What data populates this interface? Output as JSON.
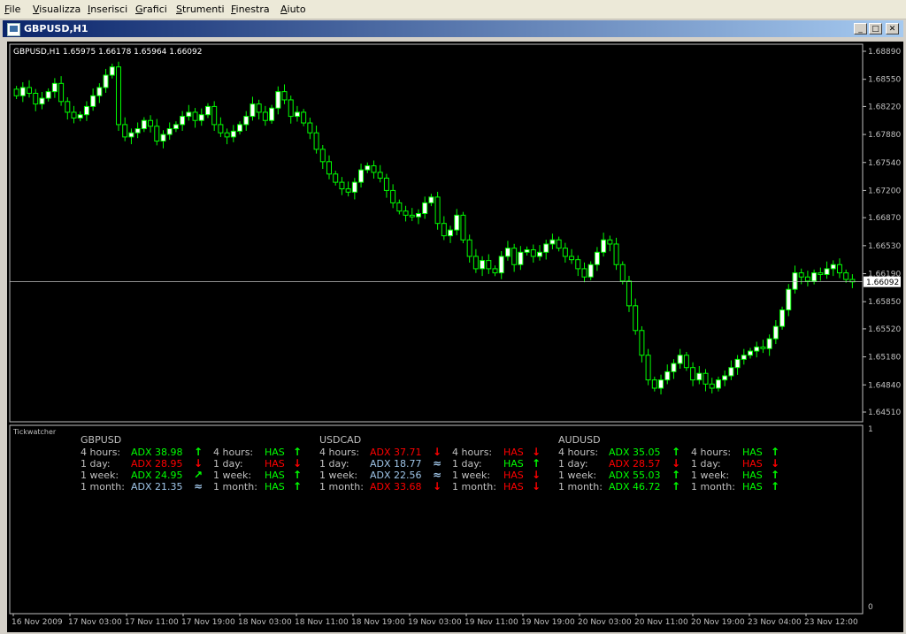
{
  "menu": [
    "File",
    "Visualizza",
    "Inserisci",
    "Grafici",
    "Strumenti",
    "Finestra",
    "Aiuto"
  ],
  "window": {
    "title": "GBPUSD,H1",
    "min_symbol": "_",
    "max_symbol": "□",
    "close_symbol": "✕"
  },
  "chart": {
    "symbol_line": "GBPUSD,H1  1.65975 1.66178 1.65964 1.66092",
    "price_ticks": [
      "1.68890",
      "1.68550",
      "1.68220",
      "1.67880",
      "1.67540",
      "1.67200",
      "1.66870",
      "1.66530",
      "1.66190",
      "1.65850",
      "1.65520",
      "1.65180",
      "1.64840",
      "1.64510"
    ],
    "current_price": "1.66092",
    "time_labels": [
      "16 Nov 2009",
      "17 Nov 03:00",
      "17 Nov 11:00",
      "17 Nov 19:00",
      "18 Nov 03:00",
      "18 Nov 11:00",
      "18 Nov 19:00",
      "19 Nov 03:00",
      "19 Nov 11:00",
      "19 Nov 19:00",
      "20 Nov 03:00",
      "20 Nov 11:00",
      "20 Nov 19:00",
      "23 Nov 04:00",
      "23 Nov 12:00"
    ],
    "indicator_name": "Tickwatcher",
    "indicator_scale_top": "1",
    "indicator_scale_bottom": "0",
    "colors": {
      "candle": "#00ff00",
      "bull_fill": "#ffffff",
      "bear_fill": "#000000",
      "green": "#00ff00",
      "red": "#ff0000",
      "blue": "#9fc5e8",
      "text": "#c0c0c0"
    }
  },
  "tickwatcher": [
    {
      "pair": "GBPUSD",
      "rows": [
        {
          "label": "4 hours:",
          "adx": "ADX 38.98",
          "adx_color": "green",
          "arrow": "up",
          "has_label": "4 hours:",
          "has": "HAS",
          "has_color": "green",
          "has_arrow": "up"
        },
        {
          "label": "1 day:",
          "adx": "ADX 28.95",
          "adx_color": "red",
          "arrow": "down",
          "has_label": "1 day:",
          "has": "HAS",
          "has_color": "red",
          "has_arrow": "down"
        },
        {
          "label": "1 week:",
          "adx": "ADX 24.95",
          "adx_color": "green",
          "arrow": "upright",
          "has_label": "1 week:",
          "has": "HAS",
          "has_color": "green",
          "has_arrow": "up"
        },
        {
          "label": "1 month:",
          "adx": "ADX 21.35",
          "adx_color": "blue",
          "arrow": "wave",
          "has_label": "1 month:",
          "has": "HAS",
          "has_color": "green",
          "has_arrow": "up"
        }
      ]
    },
    {
      "pair": "USDCAD",
      "rows": [
        {
          "label": "4 hours:",
          "adx": "ADX 37.71",
          "adx_color": "red",
          "arrow": "down",
          "has_label": "4 hours:",
          "has": "HAS",
          "has_color": "red",
          "has_arrow": "down"
        },
        {
          "label": "1 day:",
          "adx": "ADX 18.77",
          "adx_color": "blue",
          "arrow": "wave",
          "has_label": "1 day:",
          "has": "HAS",
          "has_color": "green",
          "has_arrow": "up"
        },
        {
          "label": "1 week:",
          "adx": "ADX 22.56",
          "adx_color": "blue",
          "arrow": "wave",
          "has_label": "1 week:",
          "has": "HAS",
          "has_color": "red",
          "has_arrow": "down"
        },
        {
          "label": "1 month:",
          "adx": "ADX 33.68",
          "adx_color": "red",
          "arrow": "down",
          "has_label": "1 month:",
          "has": "HAS",
          "has_color": "red",
          "has_arrow": "down"
        }
      ]
    },
    {
      "pair": "AUDUSD",
      "rows": [
        {
          "label": "4 hours:",
          "adx": "ADX 35.05",
          "adx_color": "green",
          "arrow": "up",
          "has_label": "4 hours:",
          "has": "HAS",
          "has_color": "green",
          "has_arrow": "up"
        },
        {
          "label": "1 day:",
          "adx": "ADX 28.57",
          "adx_color": "red",
          "arrow": "down",
          "has_label": "1 day:",
          "has": "HAS",
          "has_color": "red",
          "has_arrow": "down"
        },
        {
          "label": "1 week:",
          "adx": "ADX 55.03",
          "adx_color": "green",
          "arrow": "up",
          "has_label": "1 week:",
          "has": "HAS",
          "has_color": "green",
          "has_arrow": "up"
        },
        {
          "label": "1 month:",
          "adx": "ADX 46.72",
          "adx_color": "green",
          "arrow": "up",
          "has_label": "1 month:",
          "has": "HAS",
          "has_color": "green",
          "has_arrow": "up"
        }
      ]
    }
  ],
  "closes": [
    1.6835,
    1.6845,
    1.6838,
    1.6825,
    1.6832,
    1.684,
    1.685,
    1.6828,
    1.6815,
    1.6808,
    1.6812,
    1.6822,
    1.6835,
    1.6845,
    1.686,
    1.687,
    1.68,
    1.6785,
    1.679,
    1.6795,
    1.6805,
    1.6798,
    1.678,
    1.6788,
    1.6795,
    1.68,
    1.681,
    1.6815,
    1.6805,
    1.6812,
    1.6822,
    1.68,
    1.679,
    1.6785,
    1.6792,
    1.68,
    1.681,
    1.6825,
    1.6815,
    1.6805,
    1.682,
    1.684,
    1.683,
    1.681,
    1.6815,
    1.6802,
    1.679,
    1.677,
    1.6755,
    1.674,
    1.673,
    1.6722,
    1.6718,
    1.673,
    1.6745,
    1.675,
    1.6742,
    1.6735,
    1.672,
    1.6705,
    1.6695,
    1.669,
    1.6688,
    1.6692,
    1.6705,
    1.6712,
    1.668,
    1.6665,
    1.6672,
    1.669,
    1.666,
    1.664,
    1.6625,
    1.6635,
    1.6625,
    1.662,
    1.664,
    1.665,
    1.663,
    1.6645,
    1.6648,
    1.664,
    1.6645,
    1.6655,
    1.666,
    1.665,
    1.664,
    1.6636,
    1.6625,
    1.6615,
    1.663,
    1.6645,
    1.666,
    1.6655,
    1.663,
    1.661,
    1.658,
    1.655,
    1.652,
    1.649,
    1.648,
    1.649,
    1.65,
    1.651,
    1.652,
    1.6505,
    1.649,
    1.6498,
    1.6485,
    1.648,
    1.649,
    1.6495,
    1.6505,
    1.6515,
    1.652,
    1.6525,
    1.653,
    1.6528,
    1.654,
    1.6555,
    1.6575,
    1.66,
    1.662,
    1.6615,
    1.661,
    1.662,
    1.6618,
    1.6625,
    1.663,
    1.662,
    1.6612,
    1.6609
  ]
}
